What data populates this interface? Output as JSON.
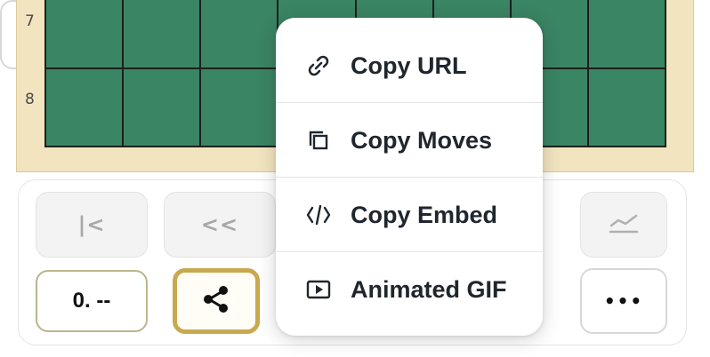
{
  "board": {
    "rank_labels": [
      "7",
      "8"
    ],
    "square_color": "#3a8563",
    "frame_color": "#f2e4bf"
  },
  "controls": {
    "first_label": "|<",
    "prev_label": "<<",
    "move_display": "0. --",
    "share_icon": "share-icon",
    "analysis_icon": "chart-icon",
    "more_label": "•••"
  },
  "share_menu": {
    "items": [
      {
        "label": "Copy URL",
        "icon": "link-icon"
      },
      {
        "label": "Copy Moves",
        "icon": "copy-icon"
      },
      {
        "label": "Copy Embed",
        "icon": "code-icon"
      },
      {
        "label": "Animated GIF",
        "icon": "play-icon"
      }
    ]
  },
  "colors": {
    "accent": "#c9a94f",
    "text_dark": "#20262e"
  }
}
